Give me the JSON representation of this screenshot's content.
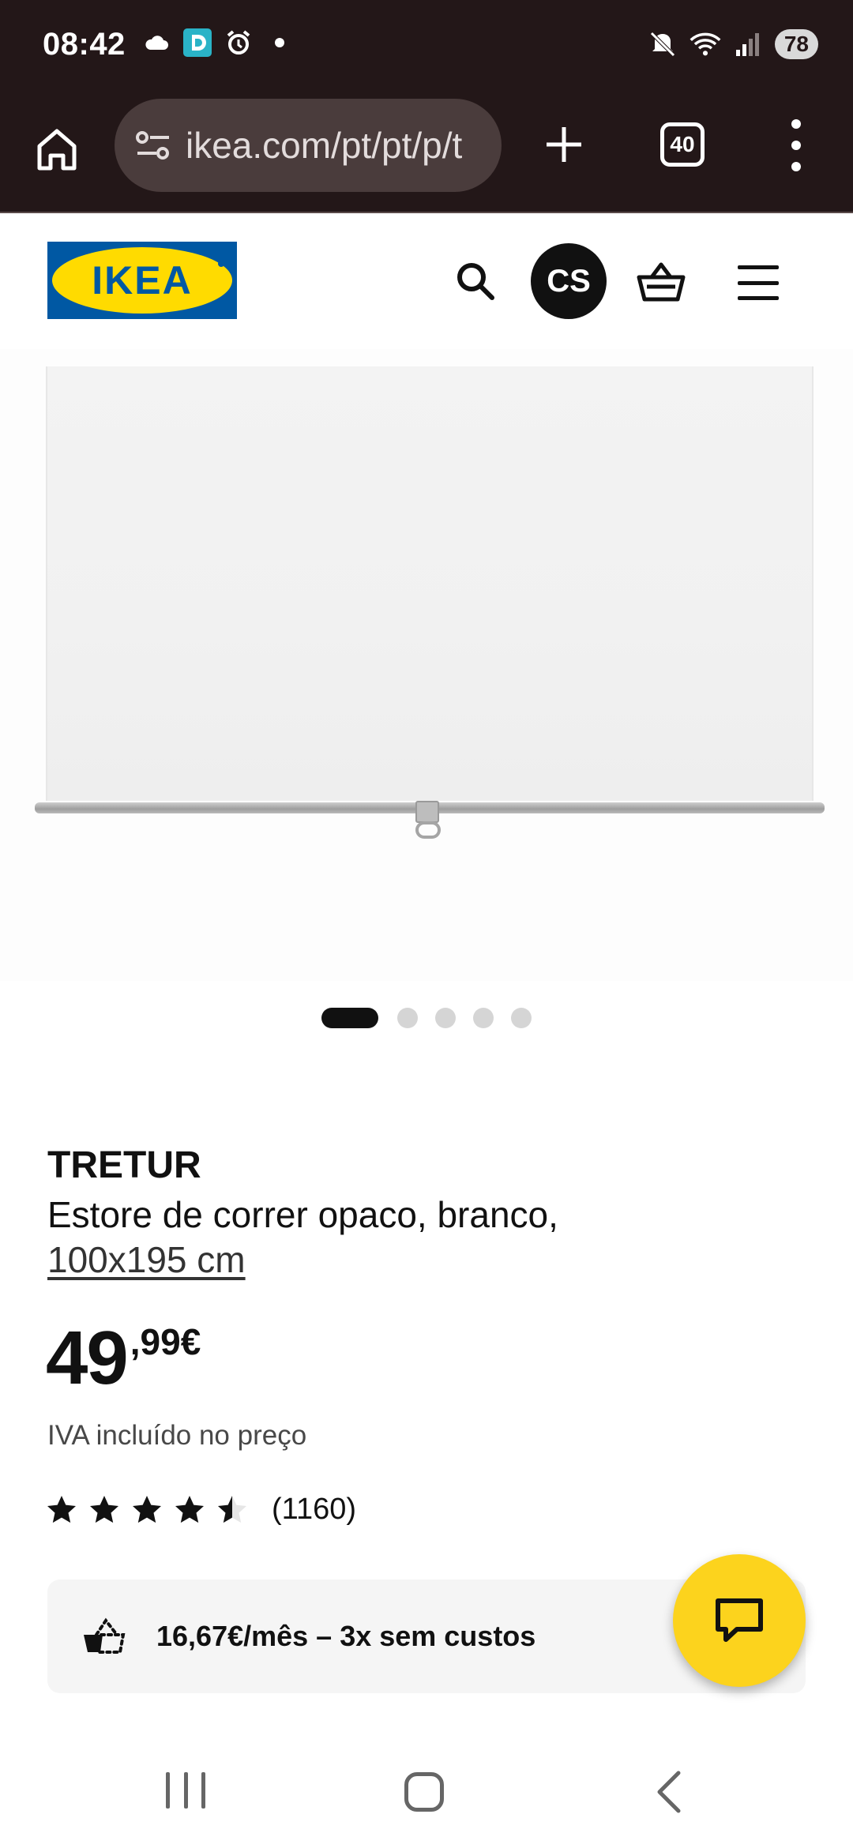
{
  "status_bar": {
    "time": "08:42",
    "battery": "78",
    "icons": [
      "cloud-icon",
      "app-notification-icon",
      "alarm-icon",
      "dot-icon",
      "mute-icon",
      "wifi-6-icon",
      "signal-icon",
      "battery-icon"
    ]
  },
  "browser": {
    "url": "ikea.com/pt/pt/p/t",
    "tab_count": "40",
    "icons": [
      "home-icon",
      "site-settings-icon",
      "new-tab-icon",
      "tabs-icon",
      "more-menu-icon"
    ]
  },
  "header": {
    "logo": "IKEA",
    "avatar_initials": "CS",
    "icons": [
      "search-icon",
      "cart-icon",
      "hamburger-menu-icon"
    ]
  },
  "gallery": {
    "dot_count": 5,
    "active_index": 0
  },
  "product": {
    "name": "TRETUR",
    "description": "Estore de correr opaco, branco,",
    "size": "100x195 cm",
    "price_int": "49",
    "price_dec": ",99€",
    "vat_note": "IVA incluído no preço",
    "rating": 4.5,
    "rating_max": 5,
    "review_count": "(1160)",
    "installment": "16,67€/mês – 3x sem custos"
  },
  "colors": {
    "chrome_bg": "#231718",
    "ikea_blue": "#0058a3",
    "ikea_yellow": "#ffdb00",
    "chat_fab": "#fcd31d"
  }
}
